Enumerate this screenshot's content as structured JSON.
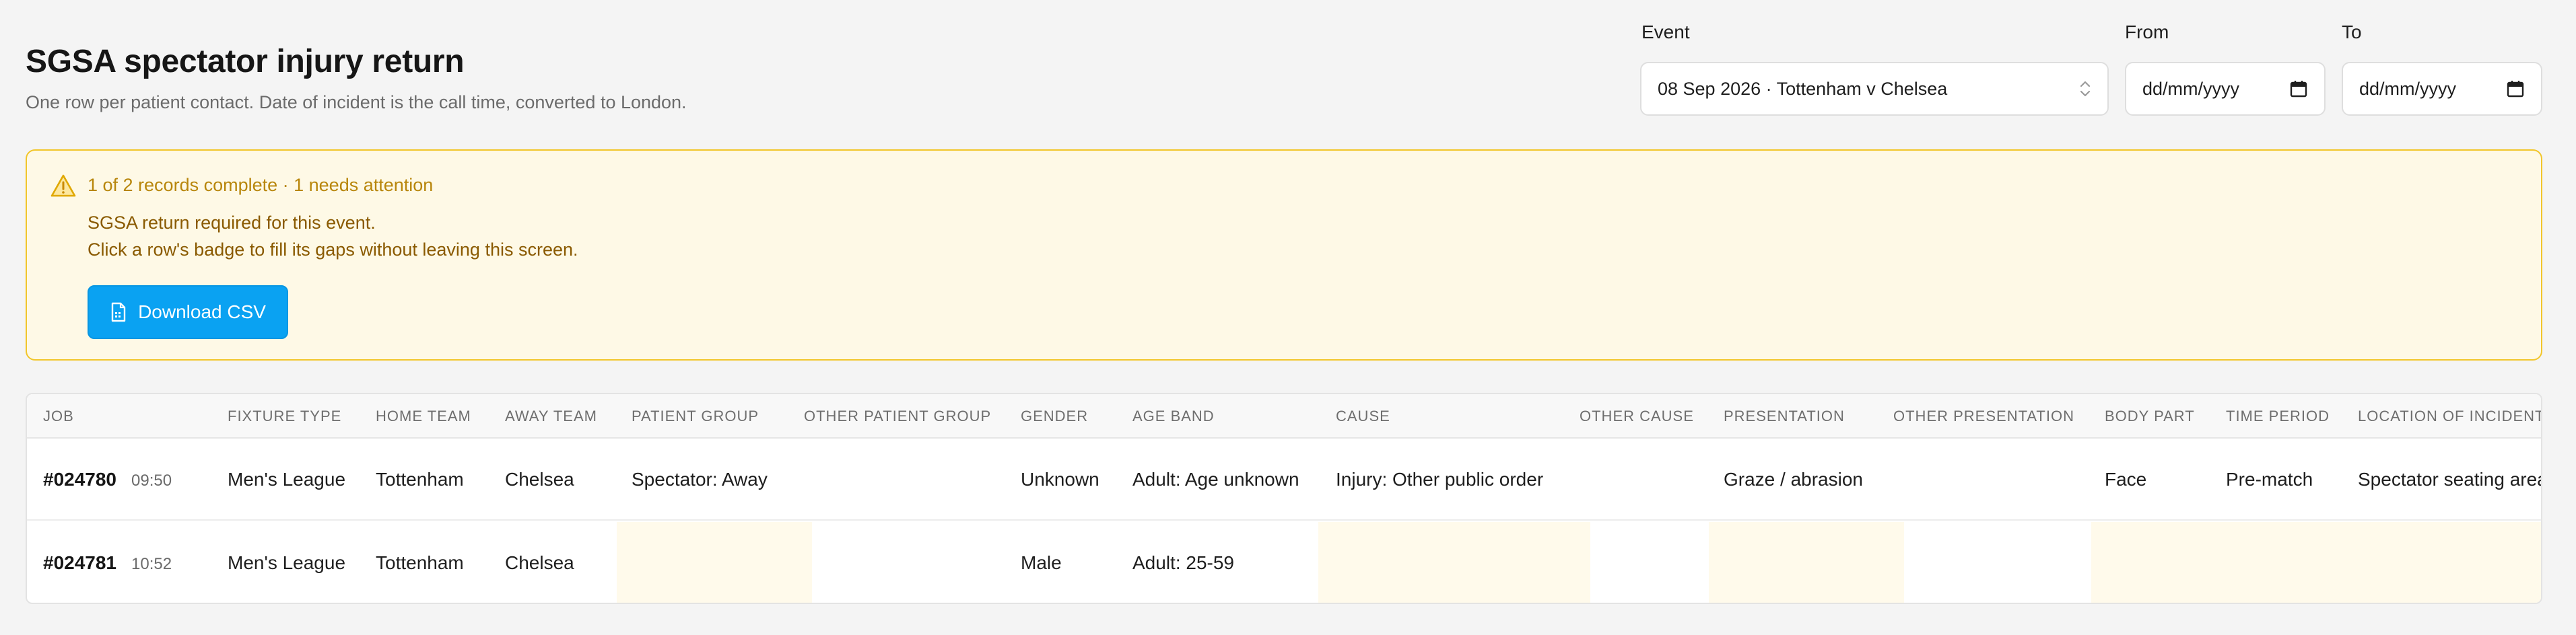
{
  "header": {
    "title": "SGSA spectator injury return",
    "subtitle": "One row per patient contact. Date of incident is the call time, converted to London."
  },
  "filters": {
    "event_label": "Event",
    "event_value": "08 Sep 2026 · Tottenham v Chelsea",
    "from_label": "From",
    "from_placeholder": "dd/mm/yyyy",
    "to_label": "To",
    "to_placeholder": "dd/mm/yyyy"
  },
  "alert": {
    "icon": "warning-triangle-icon",
    "headline": "1 of 2 records complete · 1 needs attention",
    "line1": "SGSA return required for this event.",
    "line2": "Click a row's badge to fill its gaps without leaving this screen.",
    "button_label": "Download CSV",
    "button_icon": "csv-file-icon",
    "colors": {
      "background": "#fef9e6",
      "border": "#f2c62a",
      "button": "#0aa2f2"
    }
  },
  "table": {
    "columns": [
      "JOB",
      "FIXTURE TYPE",
      "HOME TEAM",
      "AWAY TEAM",
      "PATIENT GROUP",
      "OTHER PATIENT GROUP",
      "GENDER",
      "AGE BAND",
      "CAUSE",
      "OTHER CAUSE",
      "PRESENTATION",
      "OTHER PRESENTATION",
      "BODY PART",
      "TIME PERIOD",
      "LOCATION OF INCIDENT"
    ],
    "rows": [
      {
        "job": "#024780",
        "time": "09:50",
        "fixture_type": "Men's League",
        "home_team": "Tottenham",
        "away_team": "Chelsea",
        "patient_group": "Spectator: Away",
        "other_patient_group": "",
        "gender": "Unknown",
        "age_band": "Adult: Age unknown",
        "cause": "Injury: Other public order",
        "other_cause": "",
        "presentation": "Graze / abrasion",
        "other_presentation": "",
        "body_part": "Face",
        "time_period": "Pre-match",
        "location": "Spectator seating area"
      },
      {
        "job": "#024781",
        "time": "10:52",
        "fixture_type": "Men's League",
        "home_team": "Tottenham",
        "away_team": "Chelsea",
        "patient_group": "",
        "other_patient_group": "",
        "gender": "Male",
        "age_band": "Adult: 25-59",
        "cause": "",
        "other_cause": "",
        "presentation": "",
        "other_presentation": "",
        "body_part": "",
        "time_period": "",
        "location": ""
      }
    ],
    "missing_cell_color": "#fffaeb"
  }
}
